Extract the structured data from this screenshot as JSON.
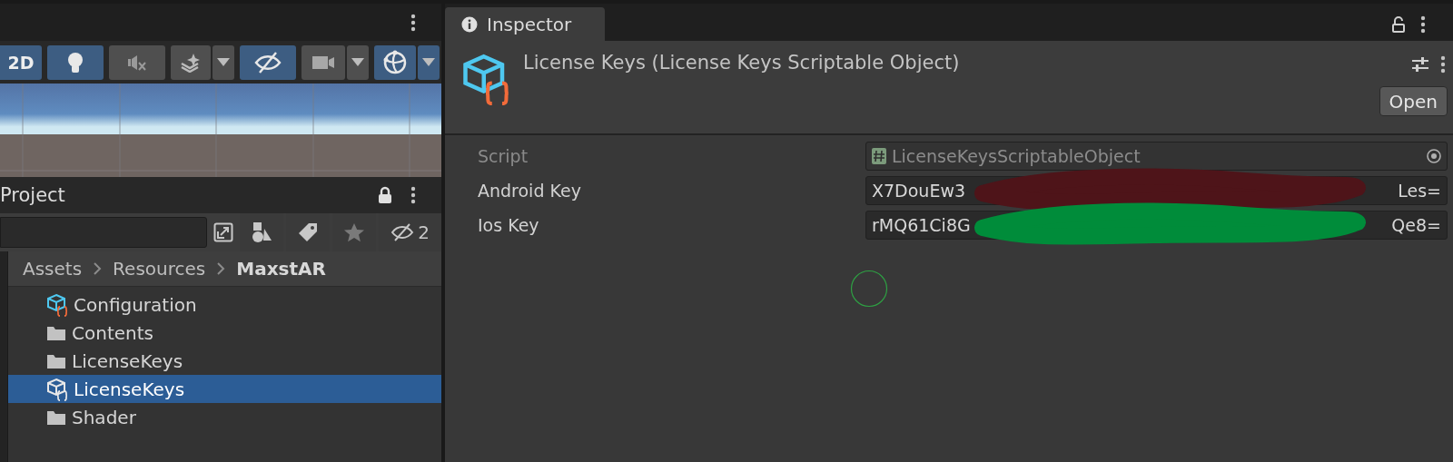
{
  "scene_toolbar": [
    {
      "kind": "text",
      "label": "2D",
      "on": true
    },
    {
      "kind": "light",
      "on": true
    },
    {
      "kind": "audio",
      "on": false
    },
    {
      "kind": "effects",
      "on": false,
      "dropdown": true
    },
    {
      "kind": "visibility",
      "on": true
    },
    {
      "kind": "camera",
      "on": false,
      "dropdown": true
    },
    {
      "kind": "gizmo",
      "on": true,
      "dropdown": true
    }
  ],
  "project": {
    "title": "Project",
    "hidden_count": "2",
    "breadcrumb": [
      "Assets",
      "Resources",
      "MaxstAR"
    ],
    "items": [
      {
        "kind": "scriptable",
        "label": "Configuration",
        "selected": false
      },
      {
        "kind": "folder",
        "label": "Contents",
        "selected": false
      },
      {
        "kind": "folder",
        "label": "LicenseKeys",
        "selected": false
      },
      {
        "kind": "scriptable",
        "label": "LicenseKeys",
        "selected": true
      },
      {
        "kind": "folder",
        "label": "Shader",
        "selected": false
      }
    ]
  },
  "inspector": {
    "tab": "Inspector",
    "title": "License Keys (License Keys Scriptable Object)",
    "open_button": "Open",
    "fields": [
      {
        "kind": "script",
        "label": "Script",
        "value": "LicenseKeysScriptableObject",
        "disabled": true
      },
      {
        "kind": "text",
        "label": "Android Key",
        "value_start": "X7DouEw3",
        "value_end": "Les=",
        "disabled": false,
        "scribble": {
          "color": "#4e1419"
        }
      },
      {
        "kind": "text",
        "label": "Ios Key",
        "value_start": "rMQ61Ci8G",
        "value_end": "Qe8=",
        "disabled": false,
        "scribble": {
          "color": "#008c3a"
        }
      }
    ]
  }
}
